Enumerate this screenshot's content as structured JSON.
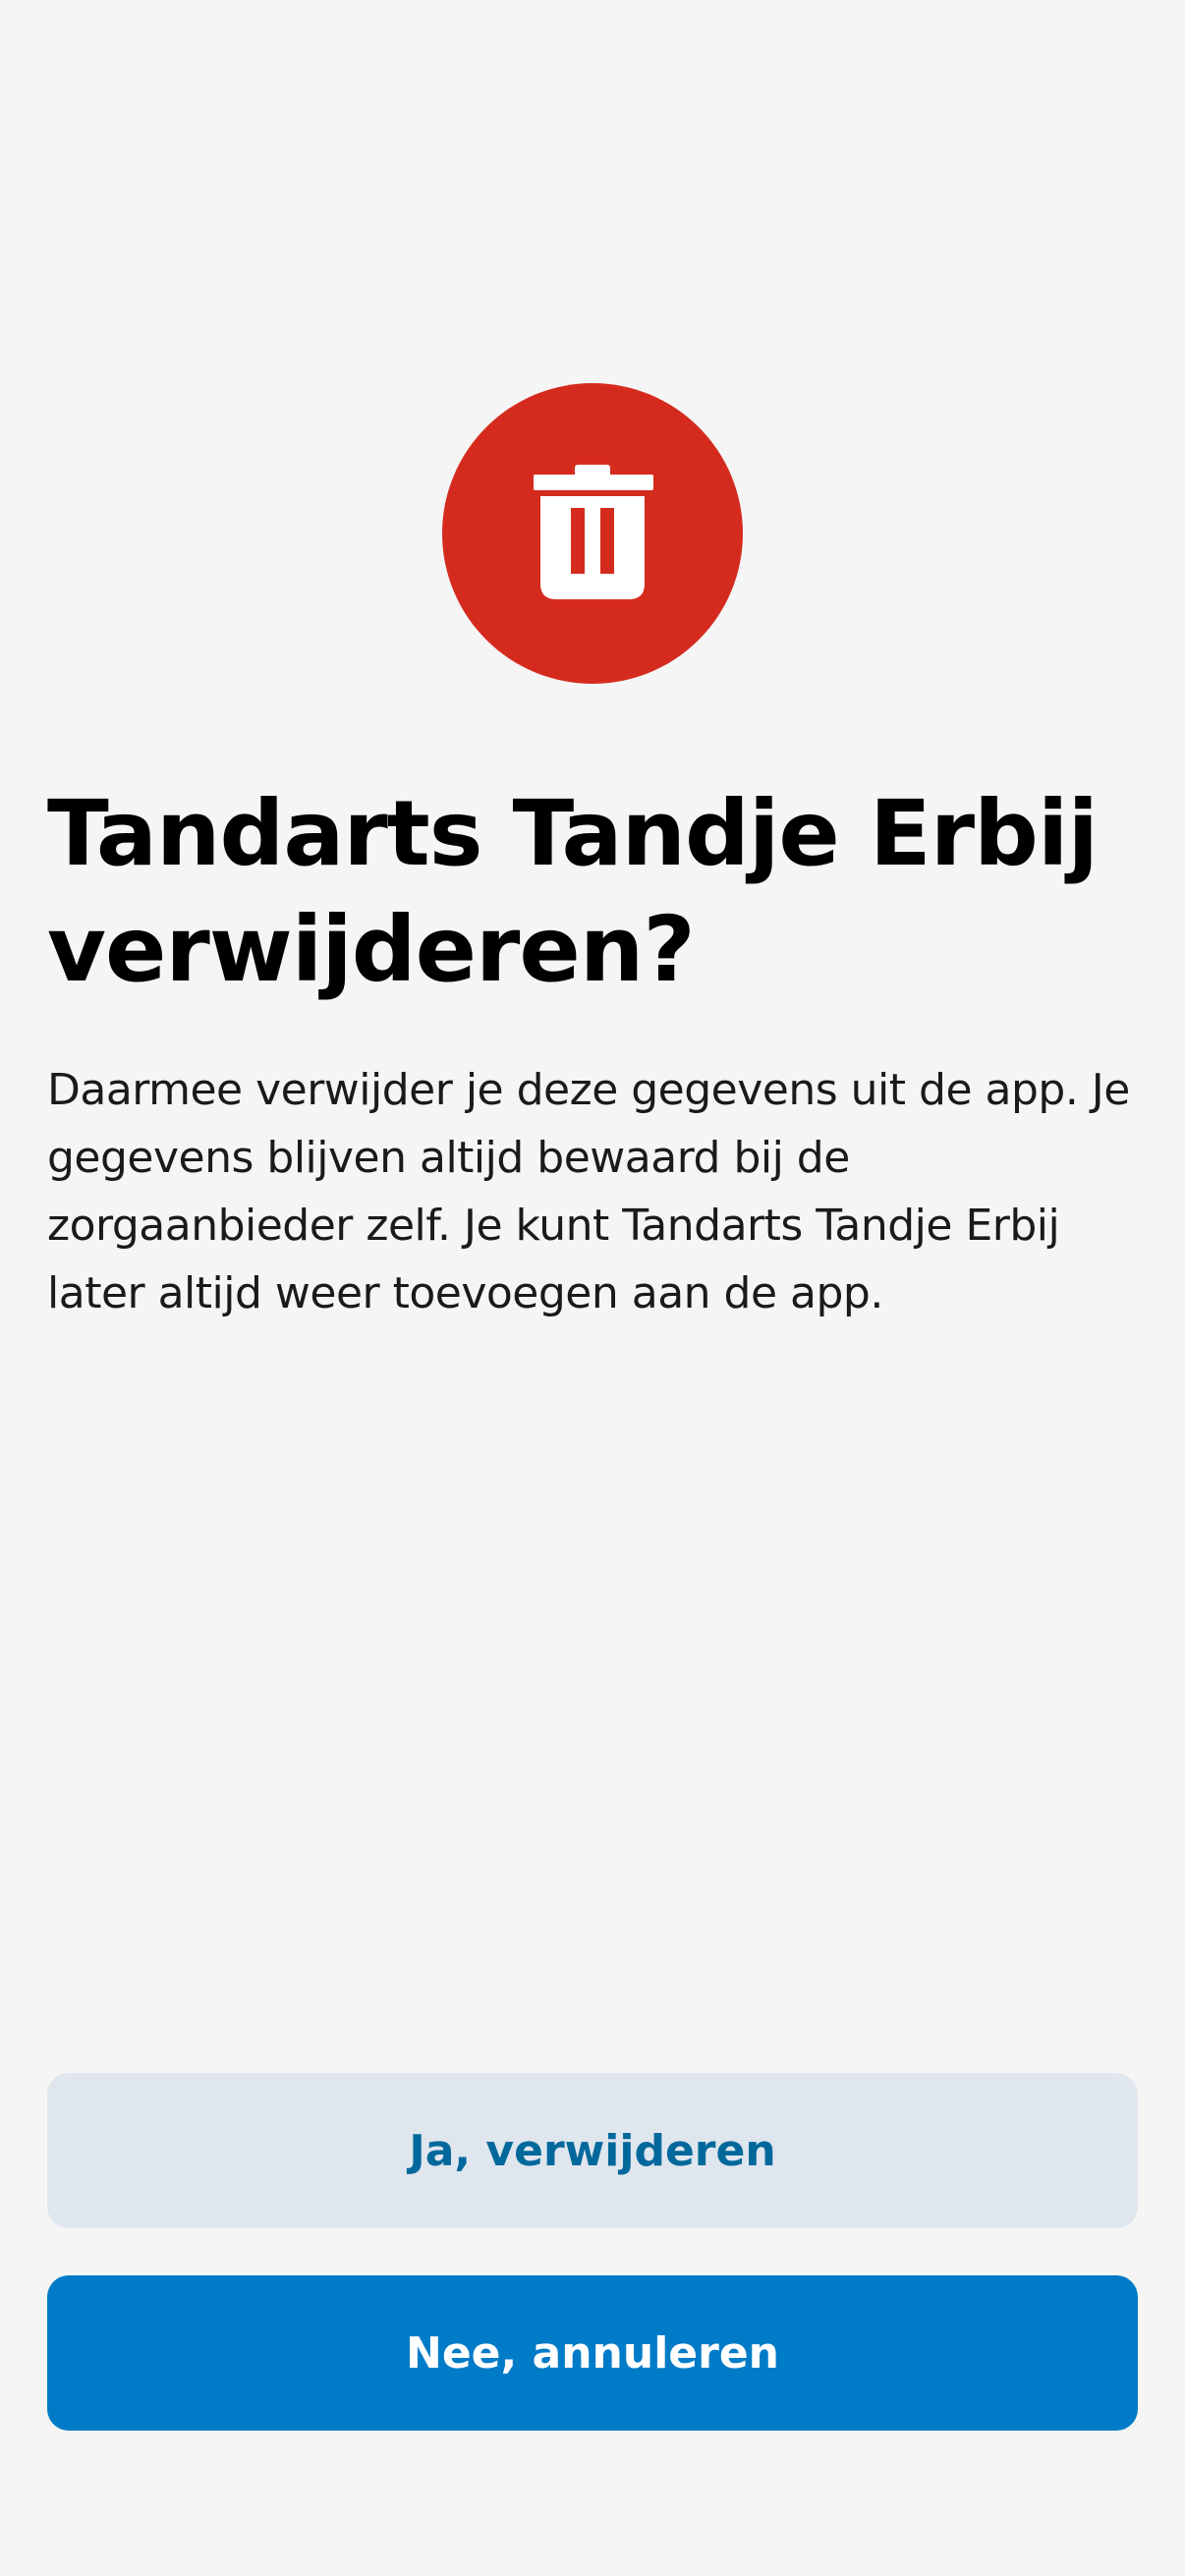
{
  "dialog": {
    "icon": "trash-icon",
    "title": "Tandarts Tandje Erbij verwijderen?",
    "body": "Daarmee verwijder je deze gegevens uit de app. Je gegevens blijven altijd bewaard bij de zorgaanbieder zelf. Je kunt Tandarts Tandje Erbij later altijd weer toevoegen aan de app."
  },
  "actions": {
    "confirm_label": "Ja, verwijderen",
    "cancel_label": "Nee, annuleren"
  },
  "colors": {
    "background": "#f5f5f5",
    "danger": "#d52b1e",
    "primary": "#007bc7",
    "secondary_bg": "#dfe6ee",
    "secondary_text": "#01689b"
  }
}
